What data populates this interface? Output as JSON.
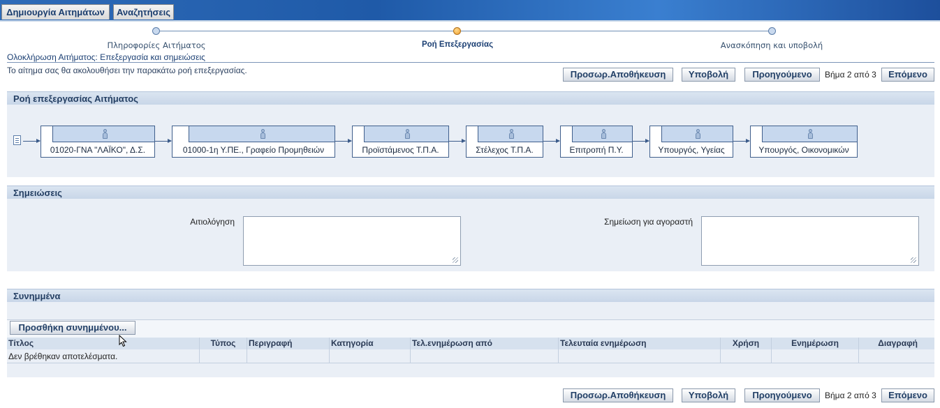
{
  "tabs": [
    {
      "label": "Δημιουργία Αιτημάτων"
    },
    {
      "label": "Αναζητήσεις"
    }
  ],
  "train": {
    "steps": [
      {
        "label": "Πληροφορίες Αιτήματος",
        "state": "visited"
      },
      {
        "label": "Ροή Επεξεργασίας",
        "state": "current"
      },
      {
        "label": "Ανασκόπηση και υποβολή",
        "state": "next"
      }
    ]
  },
  "page": {
    "title": "Ολοκλήρωση Αιτήματος: Επεξεργασία και σημειώσεις",
    "instruction": "Το αίτημα σας θα ακολουθήσει την παρακάτω ροή επεξεργασίας."
  },
  "toolbar": {
    "save_label": "Προσωρ.Αποθήκευση",
    "submit_label": "Υποβολή",
    "prev_label": "Προηγούμενο",
    "step_text": "Βήμα 2 από 3",
    "next_label": "Επόμενο"
  },
  "workflow": {
    "title": "Ροή επεξεργασίας Αιτήματος",
    "document_icon": "document-icon",
    "nodes": [
      {
        "label": "01020-ΓΝΑ \"ΛΑΪΚΟ\", Δ.Σ."
      },
      {
        "label": "01000-1η Υ.ΠΕ., Γραφείο Προμηθειών"
      },
      {
        "label": "Προϊστάμενος Τ.Π.Α."
      },
      {
        "label": "Στέλεχος Τ.Π.Α."
      },
      {
        "label": "Επιτροπή Π.Υ."
      },
      {
        "label": "Υπουργός, Υγείας"
      },
      {
        "label": "Υπουργός, Οικονομικών"
      }
    ]
  },
  "notes": {
    "title": "Σημειώσεις",
    "justification_label": "Αιτιολόγηση",
    "justification_value": "",
    "buyer_note_label": "Σημείωση για αγοραστή",
    "buyer_note_value": ""
  },
  "attachments": {
    "title": "Συνημμένα",
    "add_button_label": "Προσθήκη συνημμένου...",
    "columns": [
      "Τίτλος",
      "Τύπος",
      "Περιγραφή",
      "Κατηγορία",
      "Τελ.ενημέρωση από",
      "Τελευταία ενημέρωση",
      "Χρήση",
      "Ενημέρωση",
      "Διαγραφή"
    ],
    "empty_text": "Δεν βρέθηκαν αποτελέσματα."
  },
  "colors": {
    "accent": "#1b3f73",
    "current_step": "#f0a030",
    "panel_bg": "#eaeff6"
  }
}
